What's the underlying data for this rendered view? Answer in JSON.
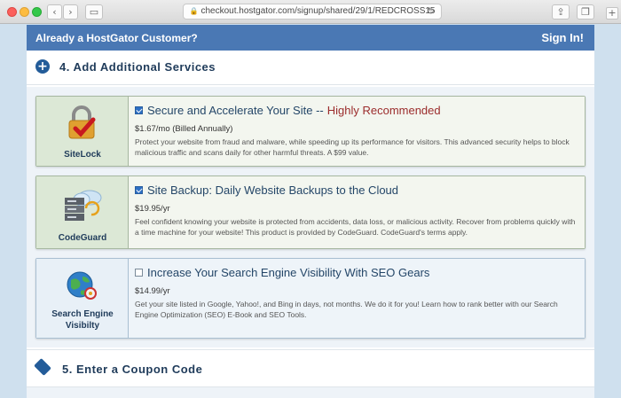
{
  "browser": {
    "url": "checkout.hostgator.com/signup/shared/29/1/REDCROSS15",
    "back_icon": "chevron-left-icon",
    "forward_icon": "chevron-right-icon"
  },
  "header_bar": {
    "left_text": "Already a HostGator Customer?",
    "right_link": "Sign In!"
  },
  "section4": {
    "title": "4. Add Additional Services"
  },
  "services": [
    {
      "logo_label": "SiteLock",
      "checked": true,
      "title": "Secure and Accelerate Your Site --",
      "highlight": "Highly Recommended",
      "price": "$1.67/mo (Billed Annually)",
      "description": "Protect your website from fraud and malware, while speeding up its performance for visitors. This advanced security helps to block malicious traffic and scans daily for other harmful threats. A $99 value."
    },
    {
      "logo_label": "CodeGuard",
      "checked": true,
      "title": "Site Backup: Daily Website Backups to the Cloud",
      "price": "$19.95/yr",
      "description": "Feel confident knowing your website is protected from accidents, data loss, or malicious activity. Recover from problems quickly with a time machine for your website! This product is provided by CodeGuard. CodeGuard's terms apply."
    },
    {
      "logo_label": "Search Engine Visibilty",
      "checked": false,
      "title": "Increase Your Search Engine Visibility With SEO Gears",
      "price": "$14.99/yr",
      "description": "Get your site listed in Google, Yahoo!, and Bing in days, not months. We do it for you! Learn how to rank better with our Search Engine Optimization (SEO) E-Book and SEO Tools."
    }
  ],
  "section5": {
    "title": "5. Enter a Coupon Code"
  },
  "colors": {
    "header_bar": "#4a78b4",
    "heading_text": "#1f3b5a",
    "highlight": "#9b2c2c",
    "checkbox": "#2d6fc4"
  }
}
